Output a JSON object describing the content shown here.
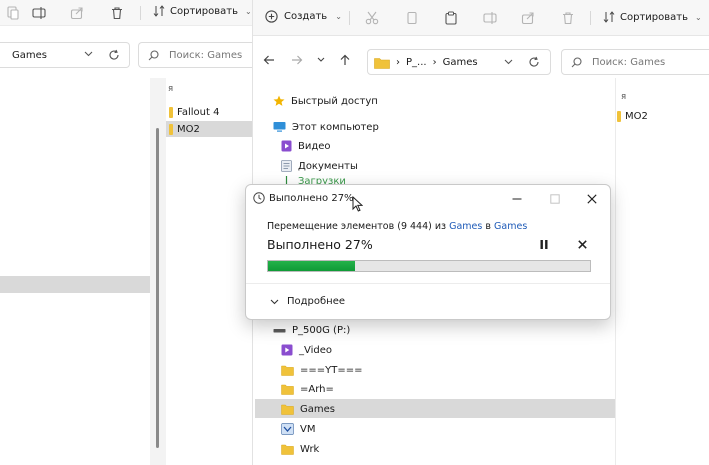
{
  "left_window": {
    "toolbar": {
      "sort_label": "Сортировать"
    },
    "address": {
      "path": "Games"
    },
    "search": {
      "placeholder": "Поиск: Games"
    },
    "column_header": "я",
    "files": [
      {
        "name": "Fallout 4",
        "selected": false
      },
      {
        "name": "MO2",
        "selected": true
      }
    ]
  },
  "right_window": {
    "toolbar": {
      "create_label": "Создать",
      "sort_label": "Сортировать"
    },
    "address": {
      "crumbs": [
        "P_...",
        "Games"
      ]
    },
    "search": {
      "placeholder": "Поиск: Games"
    },
    "column_header": "я",
    "files": [
      {
        "name": "MO2"
      }
    ],
    "nav_tree": {
      "quick_access": "Быстрый доступ",
      "this_pc": "Этот компьютер",
      "video": "Видео",
      "documents": "Документы",
      "partial": "Загрузки",
      "drive": "P_500G (P:)",
      "folders": [
        "_Video",
        "===YT===",
        "=Arh=",
        "Games",
        "VM",
        "Wrk"
      ],
      "selected": "Games"
    }
  },
  "dialog": {
    "title": "Выполнено 27%",
    "move_prefix": "Перемещение элементов (9 444) из",
    "source": "Games",
    "in_word": "в",
    "destination": "Games",
    "progress_label": "Выполнено 27%",
    "progress_fraction": 0.27,
    "more_label": "Подробнее"
  },
  "colors": {
    "progress_green": "#13a23c",
    "folder_yellow": "#f0c23a",
    "link_blue": "#1f5bb8",
    "selection_gray": "#d9d9d9"
  }
}
